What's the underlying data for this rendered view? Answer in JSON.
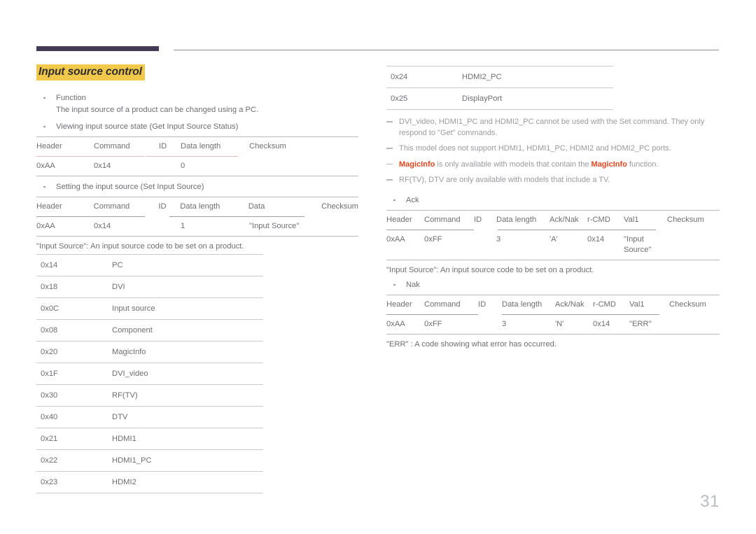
{
  "page": {
    "number": "31",
    "accent_dark": "#453a56",
    "accent_highlight": "#f0c94b",
    "accent_red": "#e2451f",
    "rule_pink": "#e3bdba"
  },
  "left": {
    "section_title": "Input source control",
    "function_bullet": {
      "label": "Function",
      "description": "The input source of a product can be changed using a PC."
    },
    "get_status": {
      "bullet": "Viewing input source state (Get Input Source Status)",
      "headers": [
        "Header",
        "Command",
        "ID",
        "Data length",
        "Checksum"
      ],
      "row": [
        "0xAA",
        "0x14",
        "",
        "0",
        ""
      ]
    },
    "set_source": {
      "bullet": "Setting the input source (Set Input Source)",
      "headers": [
        "Header",
        "Command",
        "ID",
        "Data length",
        "Data",
        "Checksum"
      ],
      "row": [
        "0xAA",
        "0x14",
        "",
        "1",
        "\"Input Source\"",
        ""
      ]
    },
    "caption": "\"Input Source\": An input source code to be set on a product.",
    "codes": [
      [
        "0x14",
        "PC"
      ],
      [
        "0x18",
        "DVI"
      ],
      [
        "0x0C",
        "Input source"
      ],
      [
        "0x08",
        "Component"
      ],
      [
        "0x20",
        "MagicInfo"
      ],
      [
        "0x1F",
        "DVI_video"
      ],
      [
        "0x30",
        "RF(TV)"
      ],
      [
        "0x40",
        "DTV"
      ],
      [
        "0x21",
        "HDMI1"
      ],
      [
        "0x22",
        "HDMI1_PC"
      ],
      [
        "0x23",
        "HDMI2"
      ]
    ]
  },
  "right": {
    "codes_continued": [
      [
        "0x24",
        "HDMI2_PC"
      ],
      [
        "0x25",
        "DisplayPort"
      ]
    ],
    "notes": [
      {
        "parts": [
          {
            "text": "DVI_video, HDMI1_PC and HDMI2_PC cannot be used with the Set command. They only respond to \"Get\" commands.",
            "style": "normal"
          }
        ]
      },
      {
        "parts": [
          {
            "text": "This model does not support HDMI1, HDMI1_PC, HDMI2 and HDMI2_PC ports.",
            "style": "normal"
          }
        ]
      },
      {
        "parts": [
          {
            "text": "MagicInfo",
            "style": "brand"
          },
          {
            "text": " is only available with models that contain the ",
            "style": "normal"
          },
          {
            "text": "MagicInfo",
            "style": "brand"
          },
          {
            "text": " function.",
            "style": "normal"
          }
        ]
      },
      {
        "parts": [
          {
            "text": "RF(TV), DTV are only available with models that include a TV.",
            "style": "normal"
          }
        ]
      }
    ],
    "ack": {
      "bullet": "Ack",
      "headers": [
        "Header",
        "Command",
        "ID",
        "Data length",
        "Ack/Nak",
        "r-CMD",
        "Val1",
        "Checksum"
      ],
      "row": [
        "0xAA",
        "0xFF",
        "",
        "3",
        "'A'",
        "0x14",
        "\"Input Source\"",
        ""
      ]
    },
    "ack_caption": "\"Input Source\": An input source code to be set on a product.",
    "nak": {
      "bullet": "Nak",
      "headers": [
        "Header",
        "Command",
        "ID",
        "Data length",
        "Ack/Nak",
        "r-CMD",
        "Val1",
        "Checksum"
      ],
      "row": [
        "0xAA",
        "0xFF",
        "",
        "3",
        "'N'",
        "0x14",
        "\"ERR\"",
        ""
      ]
    },
    "nak_caption": "\"ERR\" : A code showing what error has occurred."
  }
}
